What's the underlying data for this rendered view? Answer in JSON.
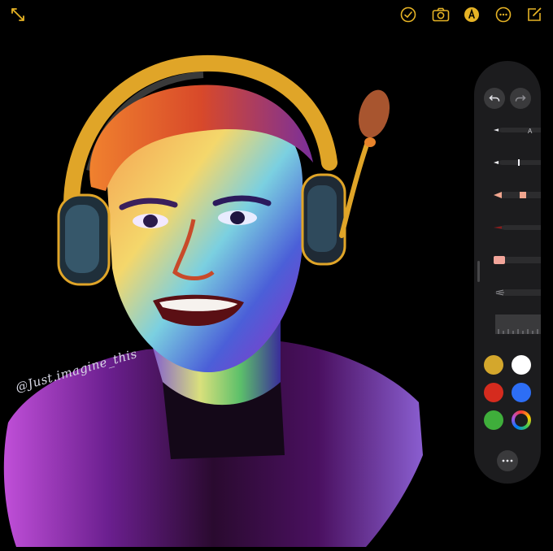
{
  "toolbar": {
    "icons": [
      "resize-icon",
      "checkmark-icon",
      "camera-icon",
      "markup-icon",
      "more-icon",
      "compose-icon"
    ],
    "accent_color": "#e6b325"
  },
  "artwork": {
    "signature": "@Just.imagine_this"
  },
  "tool_palette": {
    "tools": [
      "pen",
      "marker",
      "pencil",
      "fountain-pen",
      "eraser",
      "lasso",
      "ruler"
    ],
    "colors": [
      "#d4a72c",
      "#ffffff",
      "#d52b1e",
      "#2d6ef5",
      "#3fae3b",
      "multicolor"
    ],
    "selected_color": "multicolor"
  }
}
